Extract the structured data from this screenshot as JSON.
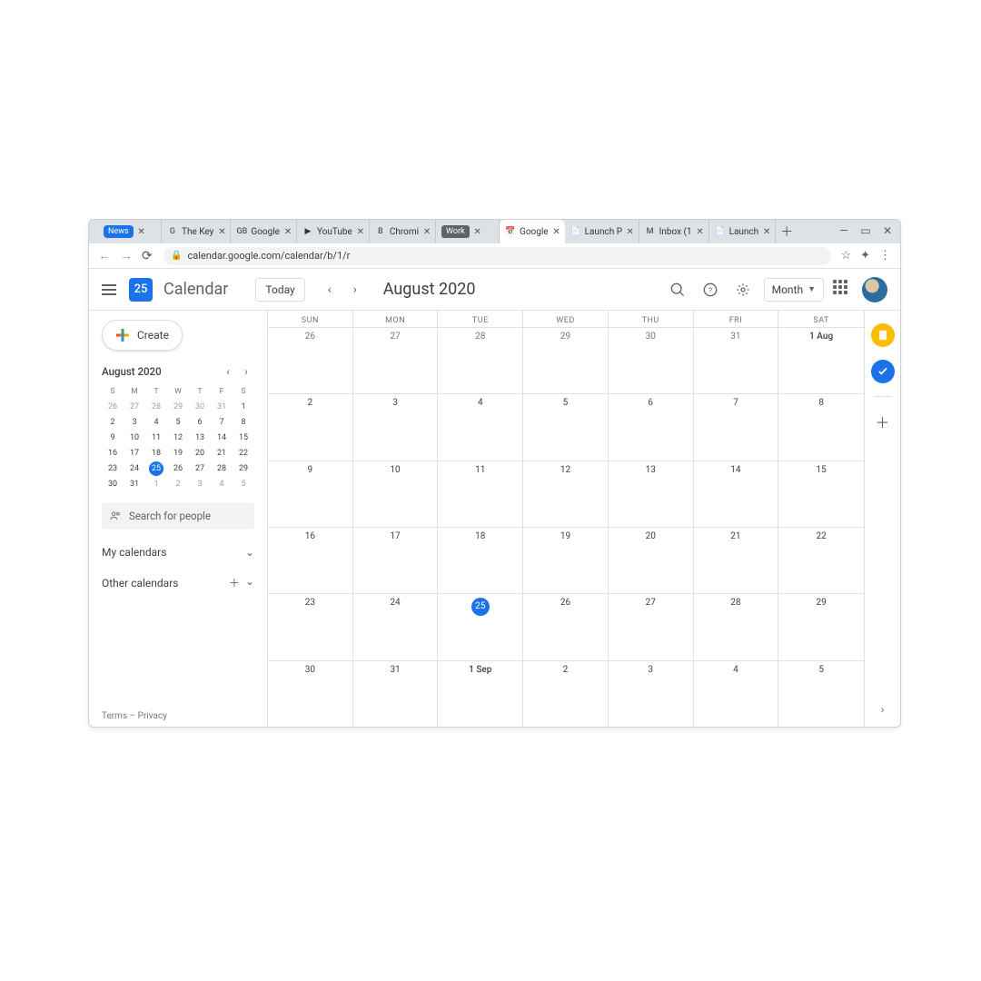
{
  "browser": {
    "tabs": [
      {
        "label": "News",
        "badge": "news"
      },
      {
        "label": "The Key",
        "fav": "G"
      },
      {
        "label": "Google",
        "fav": "GB"
      },
      {
        "label": "YouTube",
        "fav": "▶"
      },
      {
        "label": "Chromi",
        "fav": "B"
      },
      {
        "label": "Work",
        "badge": "work"
      },
      {
        "label": "Google",
        "fav": "📅",
        "active": true
      },
      {
        "label": "Launch Pr",
        "fav": "📄"
      },
      {
        "label": "Inbox (1",
        "fav": "M"
      },
      {
        "label": "Launch",
        "fav": "📄"
      }
    ],
    "url": "calendar.google.com/calendar/b/1/r"
  },
  "header": {
    "logo_day": "25",
    "app_name": "Calendar",
    "today": "Today",
    "month_title": "August 2020",
    "view": "Month"
  },
  "sidebar": {
    "create": "Create",
    "mini_month": "August 2020",
    "dow": [
      "S",
      "M",
      "T",
      "W",
      "T",
      "F",
      "S"
    ],
    "mini_grid": [
      [
        {
          "n": "26",
          "o": 1
        },
        {
          "n": "27",
          "o": 1
        },
        {
          "n": "28",
          "o": 1
        },
        {
          "n": "29",
          "o": 1
        },
        {
          "n": "30",
          "o": 1
        },
        {
          "n": "31",
          "o": 1
        },
        {
          "n": "1"
        }
      ],
      [
        {
          "n": "2"
        },
        {
          "n": "3"
        },
        {
          "n": "4"
        },
        {
          "n": "5"
        },
        {
          "n": "6"
        },
        {
          "n": "7"
        },
        {
          "n": "8"
        }
      ],
      [
        {
          "n": "9"
        },
        {
          "n": "10"
        },
        {
          "n": "11"
        },
        {
          "n": "12"
        },
        {
          "n": "13"
        },
        {
          "n": "14"
        },
        {
          "n": "15"
        }
      ],
      [
        {
          "n": "16"
        },
        {
          "n": "17"
        },
        {
          "n": "18"
        },
        {
          "n": "19"
        },
        {
          "n": "20"
        },
        {
          "n": "21"
        },
        {
          "n": "22"
        }
      ],
      [
        {
          "n": "23"
        },
        {
          "n": "24"
        },
        {
          "n": "25",
          "t": 1
        },
        {
          "n": "26"
        },
        {
          "n": "27"
        },
        {
          "n": "28"
        },
        {
          "n": "29"
        }
      ],
      [
        {
          "n": "30"
        },
        {
          "n": "31"
        },
        {
          "n": "1",
          "o": 1
        },
        {
          "n": "2",
          "o": 1
        },
        {
          "n": "3",
          "o": 1
        },
        {
          "n": "4",
          "o": 1
        },
        {
          "n": "5",
          "o": 1
        }
      ]
    ],
    "search_people": "Search for people",
    "my_calendars": "My calendars",
    "other_calendars": "Other calendars",
    "terms": "Terms",
    "privacy": "Privacy"
  },
  "grid": {
    "dow": [
      "SUN",
      "MON",
      "TUE",
      "WED",
      "THU",
      "FRI",
      "SAT"
    ],
    "rows": [
      [
        {
          "n": "26",
          "o": 1
        },
        {
          "n": "27",
          "o": 1
        },
        {
          "n": "28",
          "o": 1
        },
        {
          "n": "29",
          "o": 1
        },
        {
          "n": "30",
          "o": 1
        },
        {
          "n": "31",
          "o": 1
        },
        {
          "n": "1 Aug",
          "f": 1
        }
      ],
      [
        {
          "n": "2"
        },
        {
          "n": "3"
        },
        {
          "n": "4"
        },
        {
          "n": "5"
        },
        {
          "n": "6"
        },
        {
          "n": "7"
        },
        {
          "n": "8"
        }
      ],
      [
        {
          "n": "9"
        },
        {
          "n": "10"
        },
        {
          "n": "11"
        },
        {
          "n": "12"
        },
        {
          "n": "13"
        },
        {
          "n": "14"
        },
        {
          "n": "15"
        }
      ],
      [
        {
          "n": "16"
        },
        {
          "n": "17"
        },
        {
          "n": "18"
        },
        {
          "n": "19"
        },
        {
          "n": "20"
        },
        {
          "n": "21"
        },
        {
          "n": "22"
        }
      ],
      [
        {
          "n": "23"
        },
        {
          "n": "24"
        },
        {
          "n": "25",
          "t": 1
        },
        {
          "n": "26"
        },
        {
          "n": "27"
        },
        {
          "n": "28"
        },
        {
          "n": "29"
        }
      ],
      [
        {
          "n": "30"
        },
        {
          "n": "31"
        },
        {
          "n": "1 Sep",
          "f": 1
        },
        {
          "n": "2"
        },
        {
          "n": "3"
        },
        {
          "n": "4"
        },
        {
          "n": "5"
        }
      ]
    ]
  }
}
